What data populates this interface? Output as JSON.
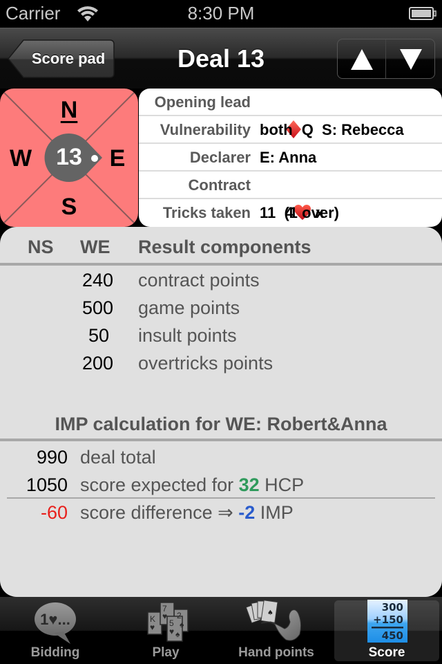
{
  "status_bar": {
    "carrier": "Carrier",
    "time": "8:30 PM",
    "wifi_icon": "wifi-icon",
    "battery_icon": "battery-icon"
  },
  "navbar": {
    "back_label": "Score pad",
    "title": "Deal 13",
    "prev_icon": "triangle-up-icon",
    "next_icon": "triangle-down-icon"
  },
  "compass": {
    "north": "N",
    "south": "S",
    "west": "W",
    "east": "E",
    "deal_number": "13",
    "dealer": "N",
    "pointer_direction": "E",
    "vulnerable_color": "#fd7b7b"
  },
  "deal_info": [
    {
      "label": "Opening lead",
      "suit": "diamond",
      "value": "Q  S: Rebecca"
    },
    {
      "label": "Vulnerability",
      "value": "both"
    },
    {
      "label": "Declarer",
      "value": "E: Anna"
    },
    {
      "label": "Contract",
      "level": "4",
      "suit": "heart",
      "value": " x"
    },
    {
      "label": "Tricks taken",
      "value": "11  (1 over)"
    }
  ],
  "result": {
    "headers": {
      "ns": "NS",
      "we": "WE",
      "components": "Result components"
    },
    "rows": [
      {
        "ns": "",
        "we": "240",
        "label": "contract points"
      },
      {
        "ns": "",
        "we": "500",
        "label": "game points"
      },
      {
        "ns": "",
        "we": "50",
        "label": "insult points"
      },
      {
        "ns": "",
        "we": "200",
        "label": "overtricks points"
      }
    ]
  },
  "imp": {
    "title": "IMP calculation for WE: Robert&Anna",
    "deal_total": {
      "value": "990",
      "label": "deal total"
    },
    "expected": {
      "value": "1050",
      "label_before": "score expected for ",
      "hcp": "32",
      "label_after": " HCP"
    },
    "difference": {
      "value": "-60",
      "label_before": "score difference ⇒ ",
      "imp": "-2",
      "label_after": " IMP"
    },
    "colors": {
      "negative": "#e8201c",
      "hcp": "#2f9a5c",
      "imp": "#2a5ccc"
    }
  },
  "tabs": [
    {
      "label": "Bidding",
      "icon": "speech-bubble-icon",
      "icon_text": "1♥...",
      "active": false
    },
    {
      "label": "Play",
      "icon": "playing-cards-icon",
      "active": false
    },
    {
      "label": "Hand points",
      "icon": "arm-holding-cards-icon",
      "active": false
    },
    {
      "label": "Score",
      "icon": "score-sum-icon",
      "icon_lines": [
        "300",
        "+150",
        "450"
      ],
      "active": true
    }
  ]
}
